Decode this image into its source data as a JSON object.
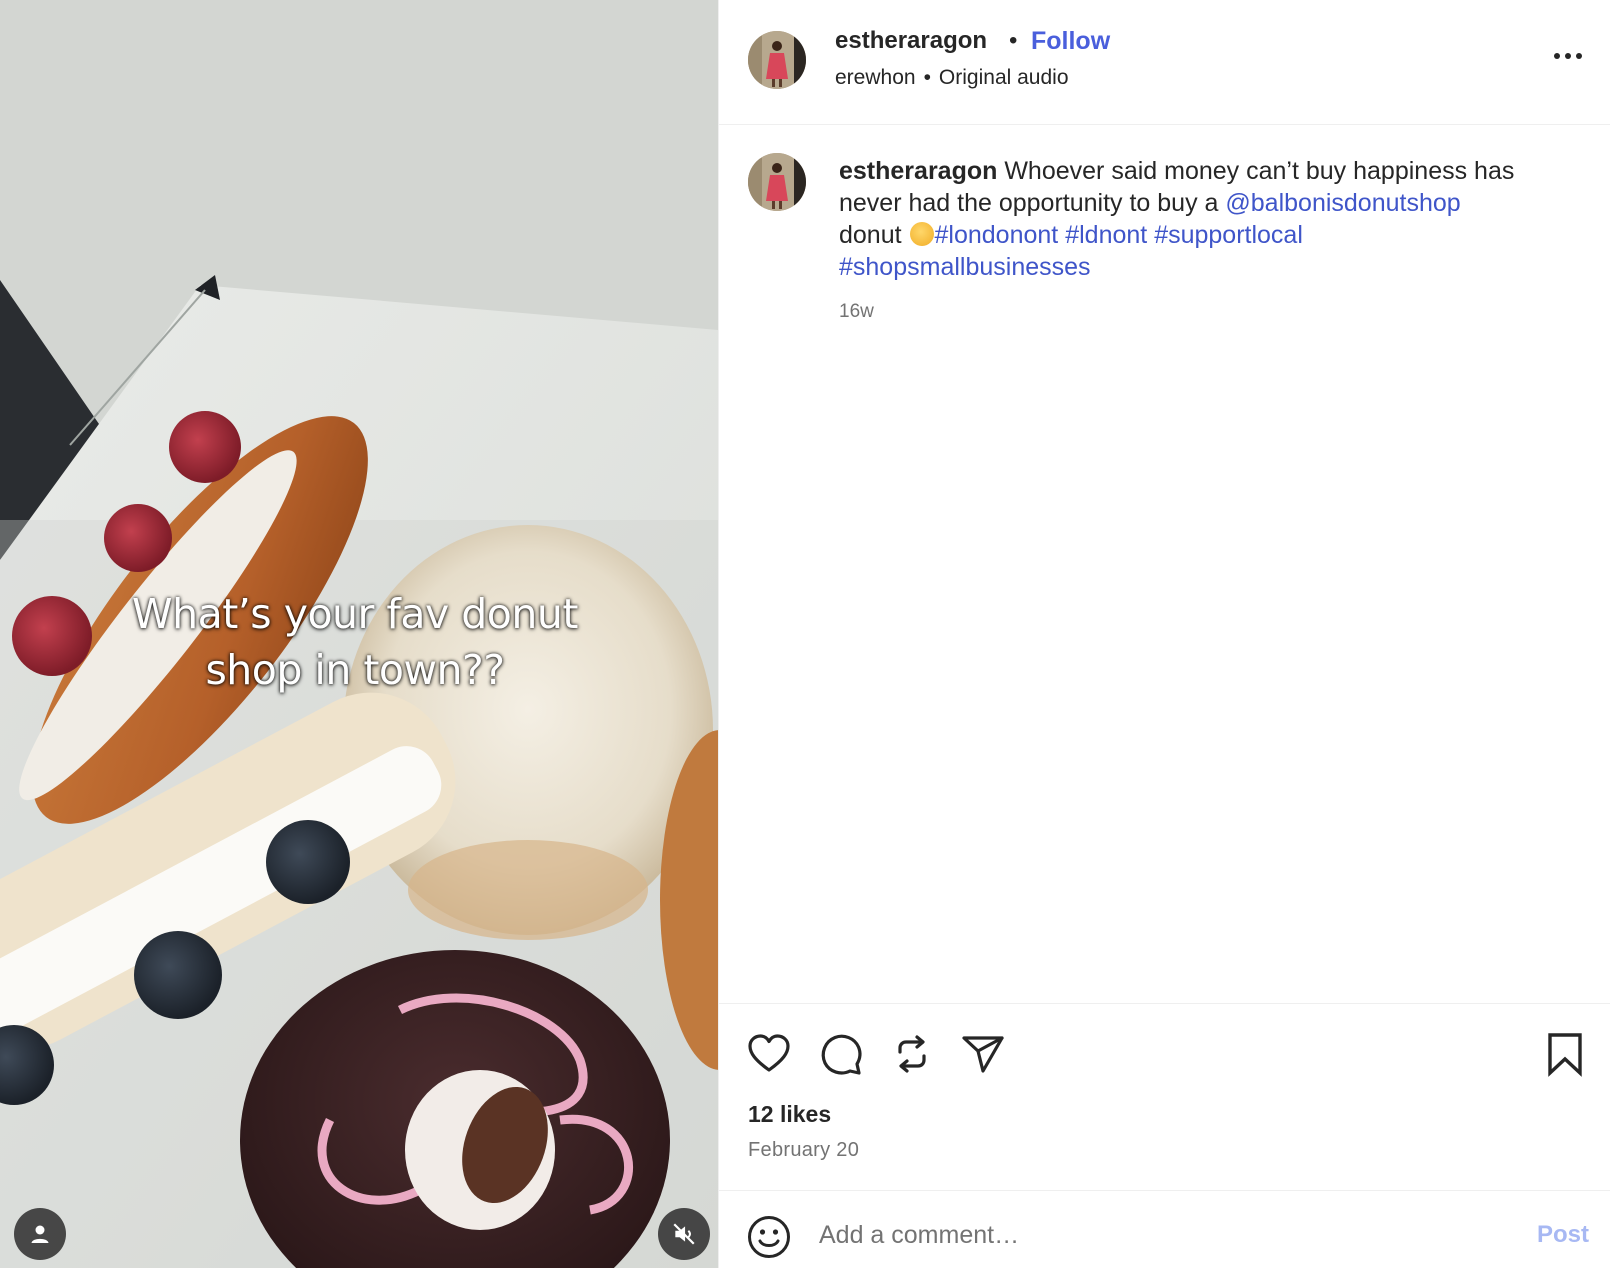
{
  "media": {
    "overlay_line1": "What’s your fav donut",
    "overlay_line2": "shop in town??",
    "user_icon": "person-icon",
    "mute_icon": "speaker-muted-icon"
  },
  "header": {
    "username": "estheraragon",
    "separator": "•",
    "follow_label": "Follow",
    "location": "erewhon",
    "audio": "Original audio",
    "more_icon": "more-horizontal-icon"
  },
  "caption": {
    "username": "estheraragon",
    "text_part1": " Whoever said money can’t buy happiness has never had the opportunity to buy a ",
    "mention": "@balbonisdonutshop",
    "text_part2": " donut ",
    "emoji_icon": "face-emoji-icon",
    "hashtags": [
      "#londonont",
      "#ldnont",
      "#supportlocal",
      "#shopsmallbusinesses"
    ],
    "time": "16w"
  },
  "actions": {
    "like_icon": "heart-icon",
    "comment_icon": "comment-icon",
    "repost_icon": "repost-icon",
    "share_icon": "send-icon",
    "save_icon": "bookmark-icon",
    "likes": "12 likes",
    "date": "February 20"
  },
  "comment": {
    "placeholder": "Add a comment…",
    "post_label": "Post",
    "emoji_icon": "smiley-icon"
  },
  "colors": {
    "link": "#3f55c9",
    "follow": "#4a5fdc",
    "post_disabled": "#a7b8f3",
    "muted_text": "#737373"
  }
}
